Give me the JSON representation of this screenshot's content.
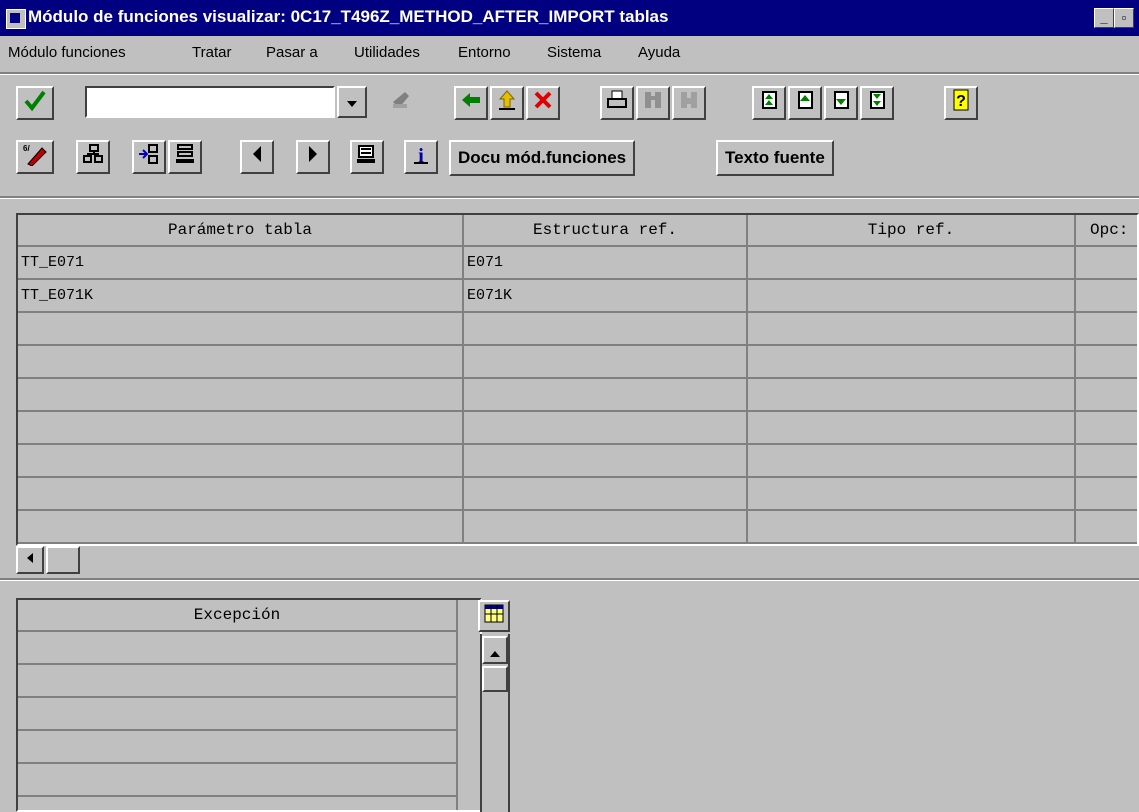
{
  "window": {
    "title": "Módulo de funciones visualizar: 0C17_T496Z_METHOD_AFTER_IMPORT tablas",
    "minimize_label": "_",
    "maximize_label": "▫"
  },
  "menu": [
    {
      "label": "Módulo funciones"
    },
    {
      "label": "Tratar"
    },
    {
      "label": "Pasar a"
    },
    {
      "label": "Utilidades"
    },
    {
      "label": "Entorno"
    },
    {
      "label": "Sistema"
    },
    {
      "label": "Ayuda"
    }
  ],
  "toolbar": {
    "command_field_value": "",
    "icons": [
      "check-icon",
      "dropdown-icon",
      "save-icon",
      "back-icon",
      "exit-icon",
      "cancel-icon",
      "print-icon",
      "find-icon",
      "find-next-icon",
      "first-page-icon",
      "previous-page-icon",
      "next-page-icon",
      "last-page-icon",
      "help-icon"
    ]
  },
  "app_toolbar": {
    "docu_button": "Docu mód.funciones",
    "source_button": "Texto fuente"
  },
  "tables_grid": {
    "headers": [
      "Parámetro tabla",
      "Estructura ref.",
      "Tipo ref.",
      "Opc:"
    ],
    "rows": [
      [
        "TT_E071",
        "E071",
        "",
        ""
      ],
      [
        "TT_E071K",
        "E071K",
        "",
        ""
      ],
      [
        "",
        "",
        "",
        ""
      ],
      [
        "",
        "",
        "",
        ""
      ],
      [
        "",
        "",
        "",
        ""
      ],
      [
        "",
        "",
        "",
        ""
      ],
      [
        "",
        "",
        "",
        ""
      ],
      [
        "",
        "",
        "",
        ""
      ],
      [
        "",
        "",
        "",
        ""
      ]
    ]
  },
  "exceptions_grid": {
    "header": "Excepción",
    "rows": [
      "",
      "",
      "",
      "",
      "",
      ""
    ]
  },
  "colors": {
    "titlebar": "#000080",
    "face": "#c0c0c0",
    "check_green": "#008000",
    "cancel_red": "#e00000",
    "help_yellow": "#ffff00"
  }
}
